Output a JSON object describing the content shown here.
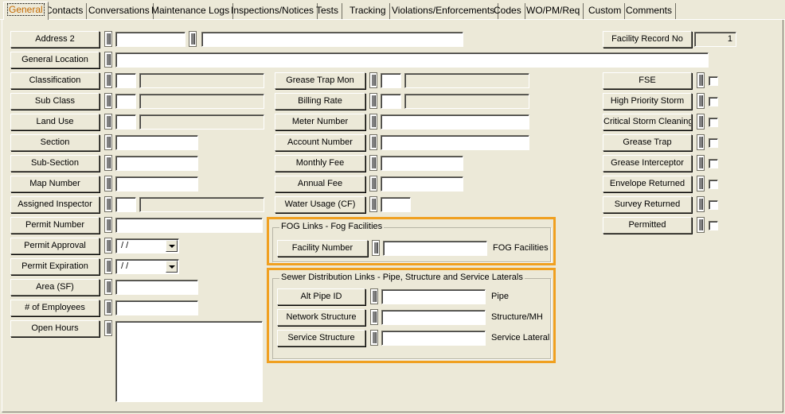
{
  "tabs": [
    {
      "label": "General",
      "active": true
    },
    {
      "label": "Contacts"
    },
    {
      "label": "Conversations"
    },
    {
      "label": "Maintenance Logs"
    },
    {
      "label": "Inspections/Notices"
    },
    {
      "label": "Tests"
    },
    {
      "label": "Tracking"
    },
    {
      "label": "Violations/Enforcements"
    },
    {
      "label": "Codes"
    },
    {
      "label": "WO/PM/Req"
    },
    {
      "label": "Custom"
    },
    {
      "label": "Comments"
    }
  ],
  "left_fields": {
    "address2": "Address 2",
    "general_location": "General Location",
    "classification": "Classification",
    "sub_class": "Sub Class",
    "land_use": "Land Use",
    "section": "Section",
    "sub_section": "Sub-Section",
    "map_number": "Map Number",
    "assigned_inspector": "Assigned Inspector",
    "permit_number": "Permit Number",
    "permit_approval": "Permit Approval",
    "permit_expiration": "Permit Expiration",
    "area": "Area (SF)",
    "employees": "# of Employees",
    "open_hours": "Open Hours"
  },
  "date_values": {
    "permit_approval": " /  /",
    "permit_expiration": " /  /"
  },
  "middle_fields": {
    "grease_trap_mon": "Grease Trap Mon",
    "billing_rate": "Billing Rate",
    "meter_number": "Meter Number",
    "account_number": "Account Number",
    "monthly_fee": "Monthly Fee",
    "annual_fee": "Annual Fee",
    "water_usage": "Water Usage (CF)"
  },
  "fog_group": {
    "legend": "FOG Links - Fog Facilities",
    "facility_number": "Facility Number",
    "suffix": "FOG Facilities"
  },
  "sewer_group": {
    "legend": "Sewer Distribution Links - Pipe, Structure and Service Laterals",
    "alt_pipe_id": "Alt Pipe ID",
    "pipe_suffix": "Pipe",
    "network_structure": "Network Structure",
    "structure_suffix": "Structure/MH",
    "service_structure": "Service Structure",
    "service_suffix": "Service Lateral"
  },
  "right_fields": {
    "facility_record_no": "Facility Record No",
    "facility_record_value": "1",
    "fse": "FSE",
    "high_priority_storm": "High Priority Storm",
    "critical_storm_cleaning": "Critical Storm Cleaning",
    "grease_trap": "Grease Trap",
    "grease_interceptor": "Grease Interceptor",
    "envelope_returned": "Envelope Returned",
    "survey_returned": "Survey Returned",
    "permitted": "Permitted"
  },
  "colors": {
    "background": "#ece9d8",
    "highlight": "#f0a020",
    "active_tab_text": "#c46a00"
  }
}
